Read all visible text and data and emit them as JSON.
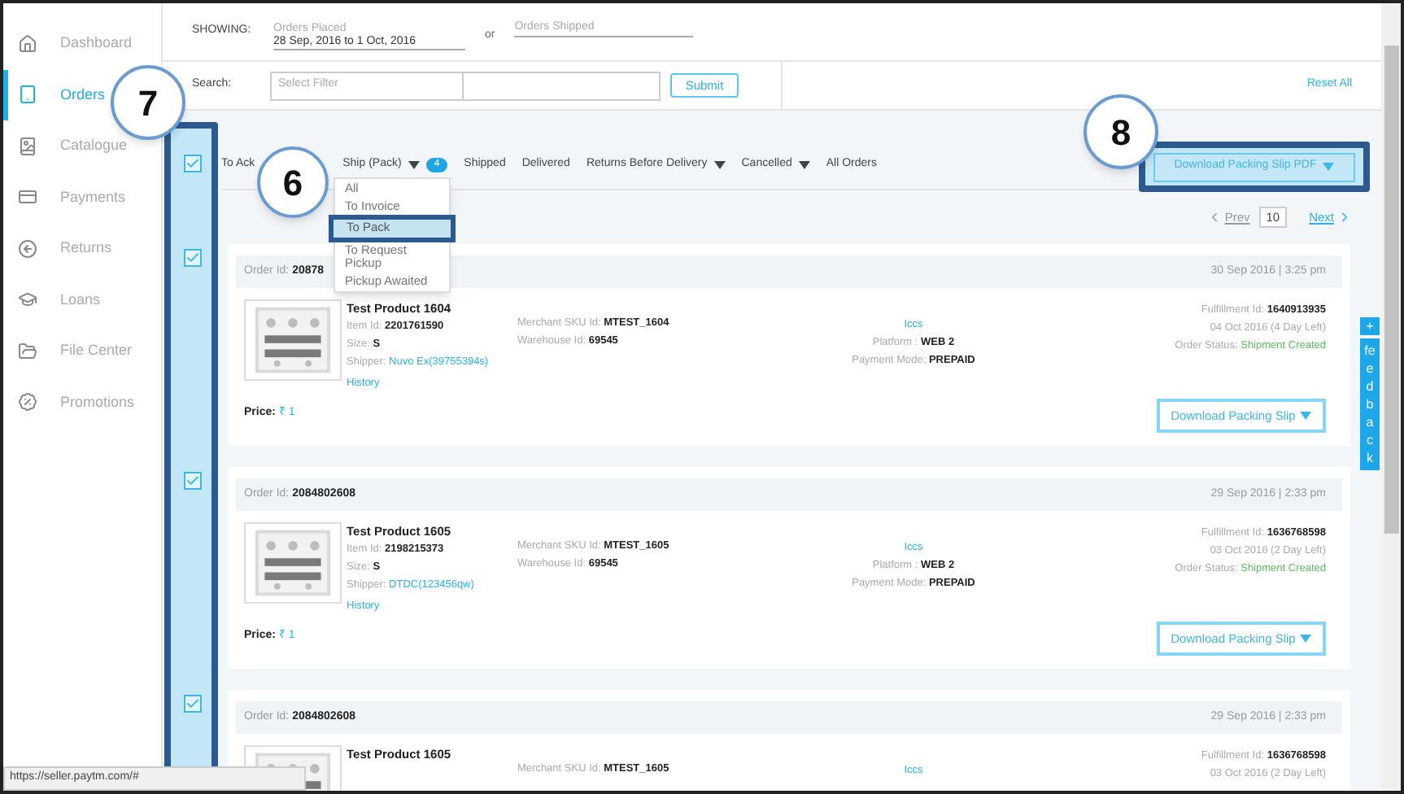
{
  "sidebar": {
    "items": [
      {
        "label": "Dashboard",
        "selected": false
      },
      {
        "label": "Orders",
        "selected": true
      },
      {
        "label": "Catalogue",
        "selected": false
      },
      {
        "label": "Payments",
        "selected": false
      },
      {
        "label": "Returns",
        "selected": false
      },
      {
        "label": "Loans",
        "selected": false
      },
      {
        "label": "File Center",
        "selected": false
      },
      {
        "label": "Promotions",
        "selected": false
      }
    ]
  },
  "filters": {
    "showing_label": "SHOWING:",
    "placed": {
      "label": "Orders Placed",
      "value": "28 Sep, 2016 to 1 Oct, 2016"
    },
    "or": "or",
    "shipped": {
      "placeholder": "Orders Shipped"
    }
  },
  "search": {
    "label": "Search:",
    "select_placeholder": "Select Filter",
    "submit": "Submit",
    "reset": "Reset All"
  },
  "select_all": {
    "checked": true
  },
  "tabs": [
    {
      "label": "To Ack",
      "dropdown": false
    },
    {
      "label": "Ship (Pack)",
      "dropdown": true,
      "badge": "4"
    },
    {
      "label": "Shipped",
      "dropdown": false
    },
    {
      "label": "Delivered",
      "dropdown": false
    },
    {
      "label": "Returns Before Delivery",
      "dropdown": true
    },
    {
      "label": "Cancelled",
      "dropdown": true
    },
    {
      "label": "All Orders",
      "dropdown": false
    }
  ],
  "dropdown_menu": [
    {
      "label": "All",
      "selected": false
    },
    {
      "label": "To Invoice",
      "selected": false
    },
    {
      "label": "To Pack",
      "selected": true
    },
    {
      "label": "To Request Pickup",
      "selected": false
    },
    {
      "label": "Pickup Awaited",
      "selected": false
    }
  ],
  "download_pdf": "Download Packing Slip PDF",
  "pagination": {
    "prev": "Prev",
    "page_size": "10",
    "next": "Next"
  },
  "orders": [
    {
      "checked": true,
      "order_id": {
        "label": "Order Id:",
        "value": "20878"
      },
      "date": "30 Sep 2016 | 3:25 pm",
      "product": "Test Product 1604",
      "details": [
        {
          "label": "Item Id:",
          "value": "2201761590",
          "link": false
        },
        {
          "label": "Size:",
          "value": "S",
          "link": false
        },
        {
          "label": "Shipper:",
          "value": "Nuvo Ex(39755394s)",
          "link": true
        }
      ],
      "history": "History",
      "sku": [
        {
          "label": "Merchant SKU Id:",
          "value": "MTEST_1604"
        },
        {
          "label": "Warehouse Id:",
          "value": "69545"
        }
      ],
      "warehouse": "Iccs",
      "platform": {
        "label": "Platform :",
        "value": "WEB 2"
      },
      "payment": {
        "label": "Payment Mode:",
        "value": "PREPAID"
      },
      "fulfillment": {
        "label": "Fulfillment Id:",
        "value": "1640913935"
      },
      "due": "04 Oct 2016 (4 Day Left)",
      "status": {
        "label": "Order Status:",
        "value": "Shipment Created"
      },
      "price": {
        "label": "Price:",
        "value": "₹ 1"
      },
      "download": "Download Packing Slip"
    },
    {
      "checked": true,
      "order_id": {
        "label": "Order Id:",
        "value": "2084802608"
      },
      "date": "29 Sep 2016 | 2:33 pm",
      "product": "Test Product 1605",
      "details": [
        {
          "label": "Item Id:",
          "value": "2198215373",
          "link": false
        },
        {
          "label": "Size:",
          "value": "S",
          "link": false
        },
        {
          "label": "Shipper:",
          "value": "DTDC(123456qw)",
          "link": true
        }
      ],
      "history": "History",
      "sku": [
        {
          "label": "Merchant SKU Id:",
          "value": "MTEST_1605"
        },
        {
          "label": "Warehouse Id:",
          "value": "69545"
        }
      ],
      "warehouse": "Iccs",
      "platform": {
        "label": "Platform :",
        "value": "WEB 2"
      },
      "payment": {
        "label": "Payment Mode:",
        "value": "PREPAID"
      },
      "fulfillment": {
        "label": "Fulfillment Id:",
        "value": "1636768598"
      },
      "due": "03 Oct 2016 (2 Day Left)",
      "status": {
        "label": "Order Status:",
        "value": "Shipment Created"
      },
      "price": {
        "label": "Price:",
        "value": "₹ 1"
      },
      "download": "Download Packing Slip"
    },
    {
      "checked": true,
      "order_id": {
        "label": "Order Id:",
        "value": "2084802608"
      },
      "date": "29 Sep 2016 | 2:33 pm",
      "product": "Test Product 1605",
      "sku": [
        {
          "label": "Merchant SKU Id:",
          "value": "MTEST_1605"
        }
      ],
      "warehouse": "Iccs",
      "fulfillment": {
        "label": "Fulfillment Id:",
        "value": "1636768598"
      },
      "due": "03 Oct 2016 (2 Day Left)"
    }
  ],
  "feedback": {
    "plus": "+",
    "label": "feedback"
  },
  "callouts": [
    "7",
    "6",
    "8"
  ],
  "status_bar": "https://seller.paytm.com/#"
}
